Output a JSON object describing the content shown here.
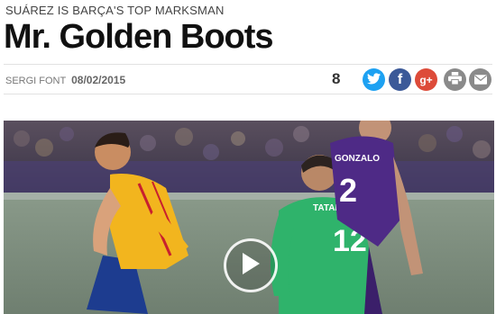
{
  "article": {
    "kicker": "SUÁREZ IS BARÇA'S TOP MARKSMAN",
    "title": "Mr. Golden Boots",
    "author": "SERGI FONT",
    "date": "08/02/2015",
    "share_count": "8"
  },
  "share": {
    "twitter_glyph": "t",
    "facebook_glyph": "f",
    "gplus_glyph": "g+",
    "colors": {
      "twitter": "#1da1f2",
      "facebook": "#3b5998",
      "gplus": "#dd4b39",
      "print": "#8a8a8a",
      "email": "#8a8a8a"
    }
  },
  "photo": {
    "jersey_right_name": "GONZALO",
    "jersey_right_number": "2",
    "jersey_keeper_name": "TATARUSANU",
    "jersey_keeper_number": "12"
  }
}
